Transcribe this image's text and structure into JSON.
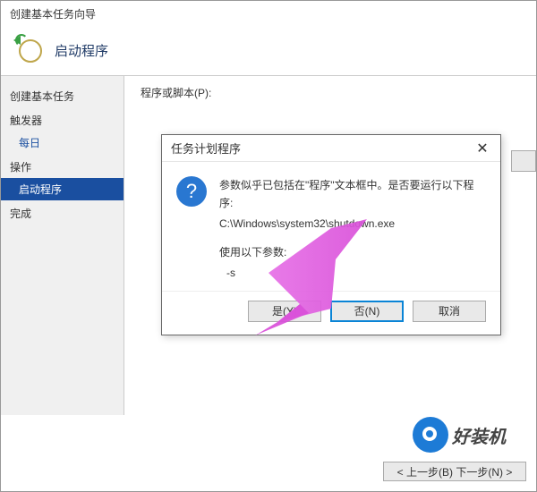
{
  "wizard": {
    "window_title": "创建基本任务向导",
    "header_title": "启动程序",
    "sidebar": {
      "group_create": "创建基本任务",
      "group_trigger": "触发器",
      "item_daily": "每日",
      "group_action": "操作",
      "item_start_program": "启动程序",
      "group_finish": "完成"
    },
    "main": {
      "program_label": "程序或脚本(P):"
    },
    "footer": {
      "prev_next": "< 上一步(B)   下一步(N) >"
    }
  },
  "dialog": {
    "title": "任务计划程序",
    "close": "✕",
    "line1": "参数似乎已包括在\"程序\"文本框中。是否要运行以下程序:",
    "line2": "C:\\Windows\\system32\\shutdown.exe",
    "line3": "使用以下参数:",
    "line4": "-s",
    "yes": "是(Y)",
    "no": "否(N)",
    "cancel": "取消"
  },
  "watermark": "好装机"
}
